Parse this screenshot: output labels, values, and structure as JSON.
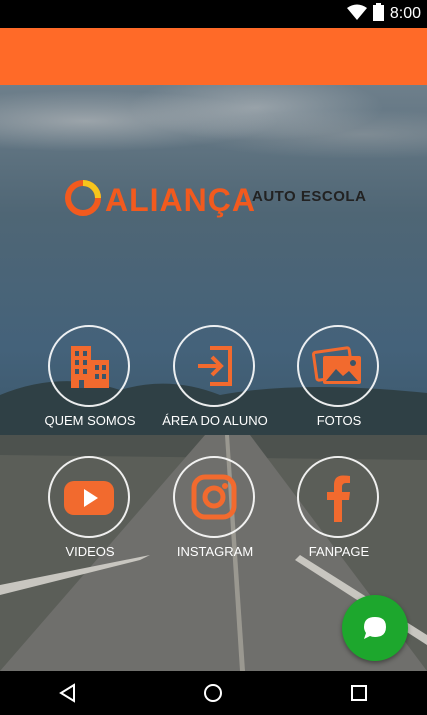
{
  "status_bar": {
    "time": "8:00",
    "icons": [
      "wifi-icon",
      "battery-icon"
    ]
  },
  "app_bar": {
    "color": "#ff6a28"
  },
  "logo": {
    "name": "ALIANÇA",
    "subtitle": "AUTO ESCOLA"
  },
  "menu": {
    "items": [
      {
        "label": "QUEM SOMOS",
        "icon": "building-icon"
      },
      {
        "label": "ÁREA DO ALUNO",
        "icon": "login-icon"
      },
      {
        "label": "FOTOS",
        "icon": "photos-icon"
      },
      {
        "label": "VIDEOS",
        "icon": "youtube-icon"
      },
      {
        "label": "INSTAGRAM",
        "icon": "instagram-icon"
      },
      {
        "label": "FANPAGE",
        "icon": "facebook-icon"
      }
    ]
  },
  "fab": {
    "icon": "chat-icon",
    "color": "#1da72d"
  },
  "nav_bar": {
    "icons": [
      "back-icon",
      "home-icon",
      "recents-icon"
    ]
  },
  "colors": {
    "accent": "#f25a1e",
    "icon": "#f26a2e"
  }
}
